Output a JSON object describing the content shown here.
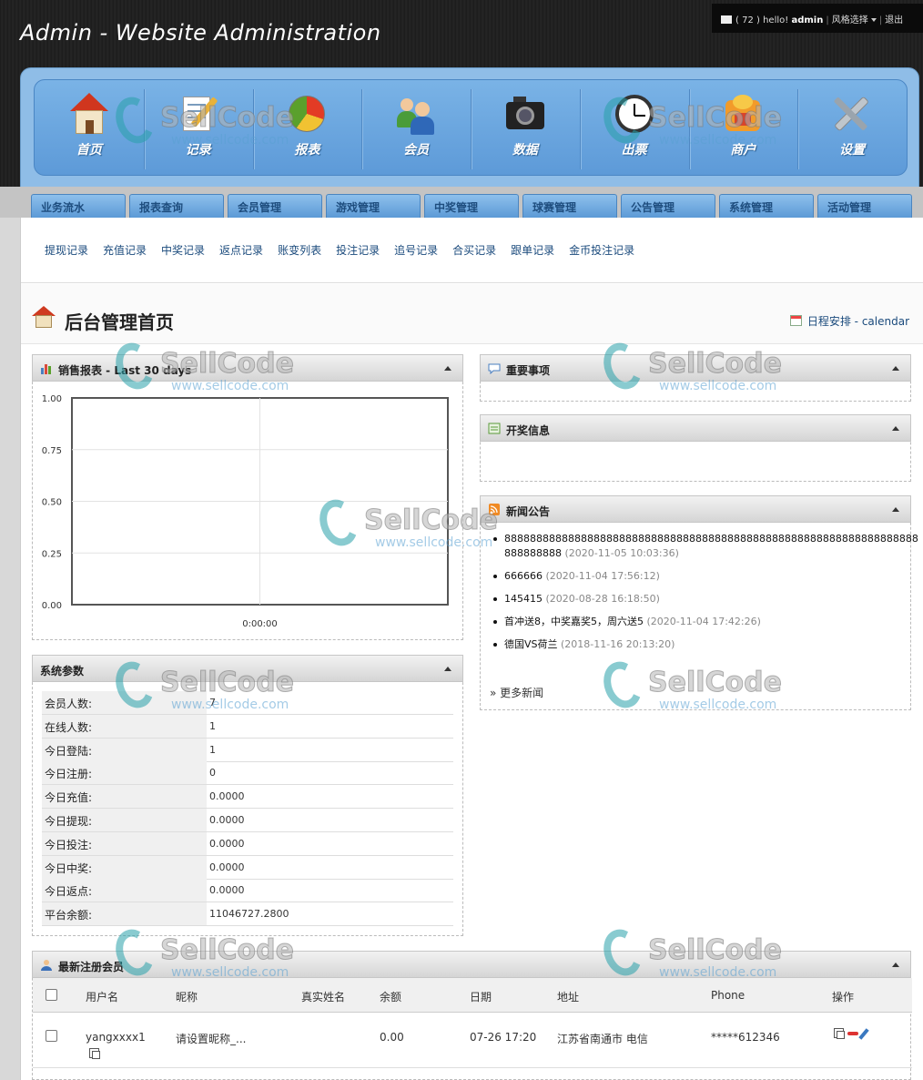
{
  "header": {
    "title": "Admin - Website Administration",
    "userbar": {
      "count": "( 72 )",
      "greeting": "hello!",
      "user": "admin",
      "style_label": "风格选择",
      "logout": "退出"
    }
  },
  "nav": [
    {
      "label": "首页",
      "icon": "house-icon"
    },
    {
      "label": "记录",
      "icon": "notepad-icon"
    },
    {
      "label": "报表",
      "icon": "pie-chart-icon"
    },
    {
      "label": "会员",
      "icon": "users-icon"
    },
    {
      "label": "数据",
      "icon": "camera-icon"
    },
    {
      "label": "出票",
      "icon": "clock-icon"
    },
    {
      "label": "商户",
      "icon": "shop-icon"
    },
    {
      "label": "设置",
      "icon": "tools-icon"
    }
  ],
  "tabs": [
    "业务流水",
    "报表查询",
    "会员管理",
    "游戏管理",
    "中奖管理",
    "球赛管理",
    "公告管理",
    "系统管理",
    "活动管理"
  ],
  "subnav": [
    "提现记录",
    "充值记录",
    "中奖记录",
    "返点记录",
    "账变列表",
    "投注记录",
    "追号记录",
    "合买记录",
    "跟单记录",
    "金币投注记录"
  ],
  "page": {
    "title": "后台管理首页",
    "calendar_link": "日程安排 - calendar"
  },
  "sales_panel": {
    "title": "销售报表 - Last 30 days"
  },
  "chart_data": {
    "type": "line",
    "x_tick_labels": [
      "0:00:00"
    ],
    "series": [],
    "y_ticks": [
      "1.00",
      "0.75",
      "0.50",
      "0.25",
      "0.00"
    ],
    "ylim": [
      0,
      1
    ],
    "grid": true
  },
  "params_panel": {
    "title": "系统参数",
    "rows": [
      {
        "label": "会员人数:",
        "value": "7"
      },
      {
        "label": "在线人数:",
        "value": "1"
      },
      {
        "label": "今日登陆:",
        "value": "1"
      },
      {
        "label": "今日注册:",
        "value": "0"
      },
      {
        "label": "今日充值:",
        "value": "0.0000"
      },
      {
        "label": "今日提现:",
        "value": "0.0000"
      },
      {
        "label": "今日投注:",
        "value": "0.0000"
      },
      {
        "label": "今日中奖:",
        "value": "0.0000"
      },
      {
        "label": "今日返点:",
        "value": "0.0000"
      },
      {
        "label": "平台余额:",
        "value": "11046727.2800"
      }
    ]
  },
  "important_panel": {
    "title": "重要事项"
  },
  "lottery_panel": {
    "title": "开奖信息"
  },
  "news_panel": {
    "title": "新闻公告",
    "items": [
      {
        "text": "88888888888888888888888888888888888888888888888888888888888888888888888888",
        "date": "(2020-11-05 10:03:36)"
      },
      {
        "text": "666666",
        "date": "(2020-11-04 17:56:12)"
      },
      {
        "text": "145415",
        "date": "(2020-08-28 16:18:50)"
      },
      {
        "text": "首冲送8，中奖嘉奖5，周六送5",
        "date": "(2020-11-04 17:42:26)"
      },
      {
        "text": "德国VS荷兰",
        "date": "(2018-11-16 20:13:20)"
      }
    ],
    "more": "» 更多新闻"
  },
  "members_panel": {
    "title": "最新注册会员",
    "columns": [
      "用户名",
      "昵称",
      "真实姓名",
      "余额",
      "日期",
      "地址",
      "Phone",
      "操作"
    ],
    "rows": [
      {
        "username": "yangxxxx1",
        "nickname": "请设置昵称_...",
        "realname": "",
        "balance": "0.00",
        "date": "07-26 17:20",
        "address": "江苏省南通市 电信",
        "phone": "*****612346"
      }
    ]
  },
  "watermark": {
    "word": "SellCode",
    "url": "www.sellcode.com"
  }
}
